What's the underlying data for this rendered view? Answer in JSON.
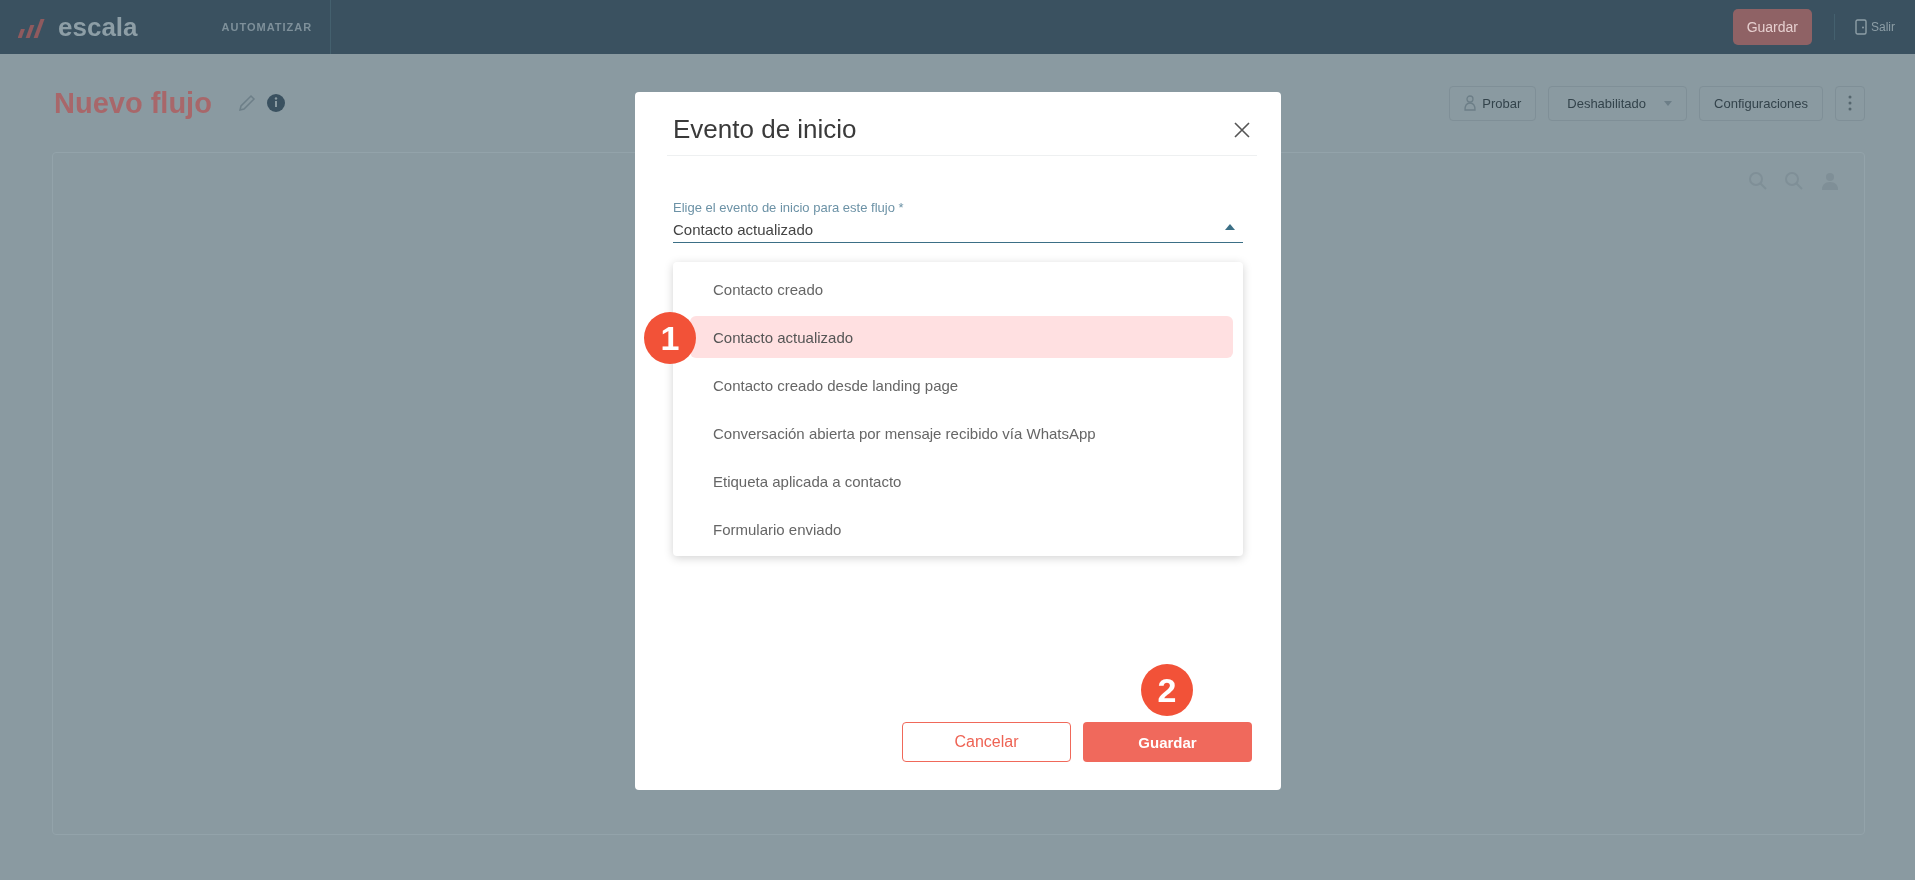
{
  "topbar": {
    "logo": "escala",
    "section": "AUTOMATIZAR",
    "save_button": "Guardar",
    "exit_link": "Salir"
  },
  "header": {
    "title": "Nuevo flujo",
    "test_button": "Probar",
    "status_dropdown": "Deshabilitado",
    "settings_button": "Configuraciones"
  },
  "modal": {
    "title": "Evento de inicio",
    "field": {
      "label": "Elige el evento de inicio para este flujo *",
      "value": "Contacto actualizado",
      "expanded": true
    },
    "options": [
      {
        "label": "Contacto creado",
        "selected": false
      },
      {
        "label": "Contacto actualizado",
        "selected": true
      },
      {
        "label": "Contacto creado desde landing page",
        "selected": false
      },
      {
        "label": "Conversación abierta por mensaje recibido vía WhatsApp",
        "selected": false
      },
      {
        "label": "Etiqueta aplicada a contacto",
        "selected": false
      },
      {
        "label": "Formulario enviado",
        "selected": false
      }
    ],
    "cancel_button": "Cancelar",
    "save_button": "Guardar"
  },
  "markers": [
    {
      "label": "1"
    },
    {
      "label": "2"
    }
  ]
}
